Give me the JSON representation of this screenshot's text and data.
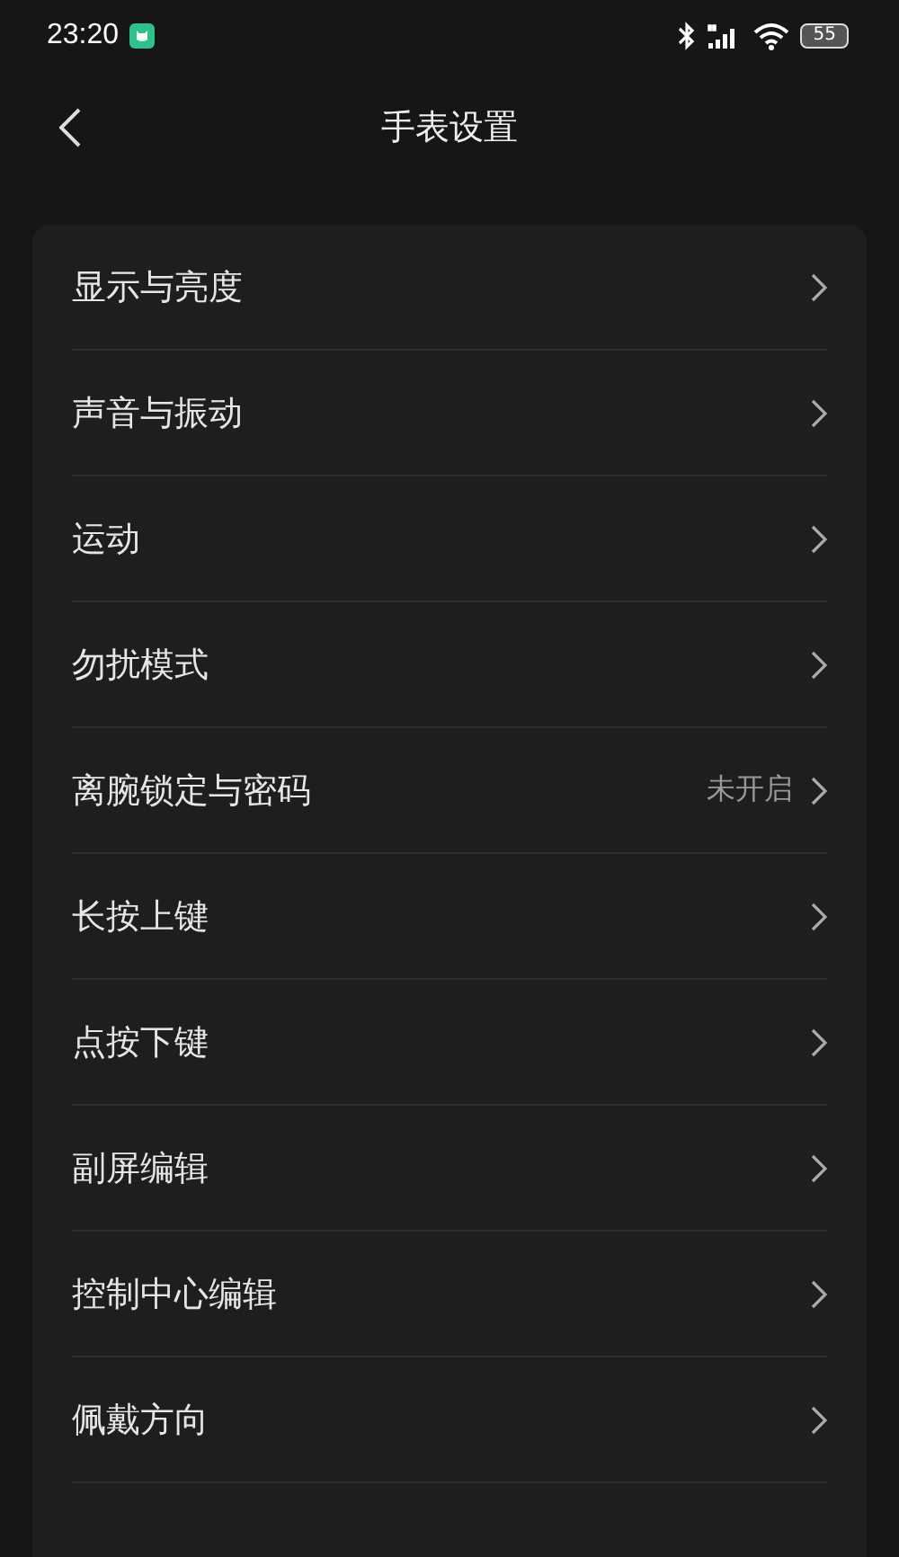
{
  "status_bar": {
    "time": "23:20",
    "battery": "55"
  },
  "header": {
    "title": "手表设置"
  },
  "items": [
    {
      "label": "显示与亮度"
    },
    {
      "label": "声音与振动"
    },
    {
      "label": "运动"
    },
    {
      "label": "勿扰模式"
    },
    {
      "label": "离腕锁定与密码",
      "value": "未开启"
    },
    {
      "label": "长按上键"
    },
    {
      "label": "点按下键"
    },
    {
      "label": "副屏编辑"
    },
    {
      "label": "控制中心编辑"
    },
    {
      "label": "佩戴方向"
    }
  ]
}
